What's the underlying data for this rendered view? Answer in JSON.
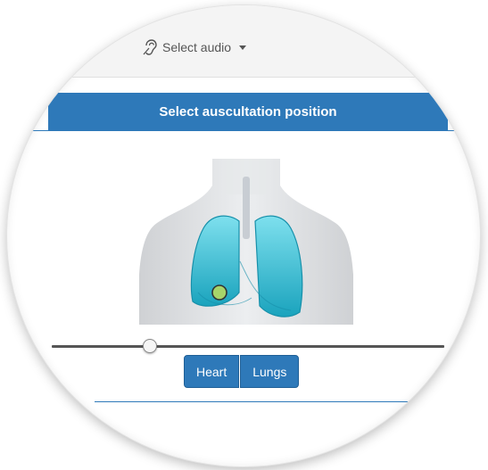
{
  "audio": {
    "label": "Select audio",
    "icon": "hearing-icon"
  },
  "banner": {
    "title": "Select auscultation position",
    "color": "#2e79b9"
  },
  "diagram": {
    "marker_color": "#a6d46a",
    "lung_color": "#39c1d6"
  },
  "slider": {
    "value": 0.25
  },
  "buttons": {
    "heart": "Heart",
    "lungs": "Lungs"
  }
}
